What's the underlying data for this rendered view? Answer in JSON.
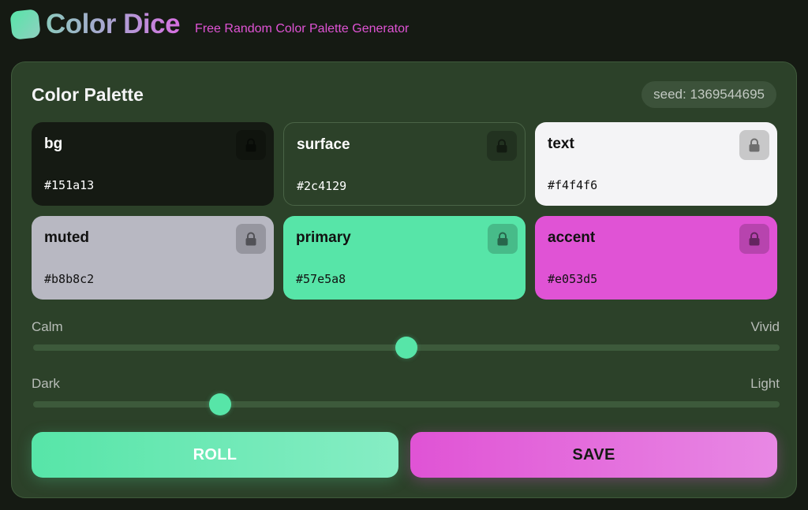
{
  "header": {
    "title": "Color Dice",
    "tagline": "Free Random Color Palette Generator"
  },
  "palette": {
    "title": "Color Palette",
    "seed_label": "seed: 1369544695",
    "swatches": [
      {
        "name": "bg",
        "hex": "#151a13",
        "text_color": "#ffffff",
        "locked": false
      },
      {
        "name": "surface",
        "hex": "#2c4129",
        "text_color": "#ffffff",
        "locked": false
      },
      {
        "name": "text",
        "hex": "#f4f4f6",
        "text_color": "#111111",
        "locked": false
      },
      {
        "name": "muted",
        "hex": "#b8b8c2",
        "text_color": "#111111",
        "locked": false
      },
      {
        "name": "primary",
        "hex": "#57e5a8",
        "text_color": "#111111",
        "locked": false
      },
      {
        "name": "accent",
        "hex": "#e053d5",
        "text_color": "#111111",
        "locked": false
      }
    ]
  },
  "sliders": [
    {
      "left_label": "Calm",
      "right_label": "Vivid",
      "value": 0.5
    },
    {
      "left_label": "Dark",
      "right_label": "Light",
      "value": 0.25
    }
  ],
  "actions": {
    "roll_label": "ROLL",
    "save_label": "SAVE"
  },
  "icons": {
    "lock": "lock-icon",
    "logo": "dice-logo-icon"
  },
  "colors": {
    "background": "#151a13",
    "surface": "#2c4129",
    "primary": "#57e5a8",
    "accent": "#e053d5"
  }
}
